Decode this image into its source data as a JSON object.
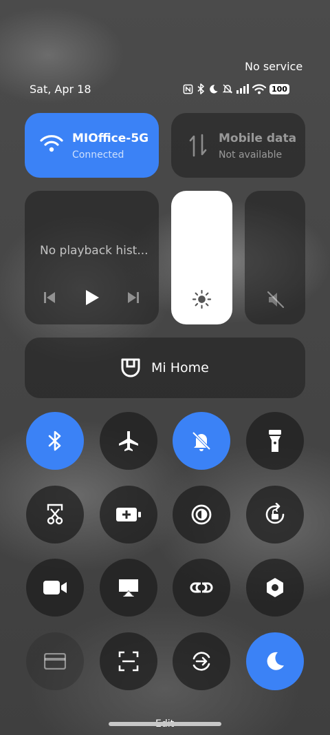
{
  "status": {
    "carrier": "No service",
    "date": "Sat, Apr 18",
    "battery": "100"
  },
  "wifi_tile": {
    "name": "MIOffice-5G",
    "status": "Connected"
  },
  "mobile_tile": {
    "title": "Mobile data",
    "status": "Not available"
  },
  "media": {
    "text": "No playback hist..."
  },
  "brightness_level": 1.0,
  "mi_home": {
    "label": "Mi Home"
  },
  "toggles": [
    {
      "name": "bluetooth",
      "active": true
    },
    {
      "name": "airplane-mode",
      "active": false
    },
    {
      "name": "mute",
      "active": true
    },
    {
      "name": "flashlight",
      "active": false
    },
    {
      "name": "screenshot",
      "active": false
    },
    {
      "name": "battery-saver",
      "active": false
    },
    {
      "name": "reading-mode",
      "active": false
    },
    {
      "name": "auto-rotate",
      "active": false
    },
    {
      "name": "screen-recorder",
      "active": false
    },
    {
      "name": "cast",
      "active": false
    },
    {
      "name": "link",
      "active": false
    },
    {
      "name": "settings",
      "active": false
    },
    {
      "name": "card",
      "active": false
    },
    {
      "name": "scanner",
      "active": false
    },
    {
      "name": "sync",
      "active": false
    },
    {
      "name": "dark-mode",
      "active": true
    }
  ],
  "footer": {
    "edit_label": "Edit"
  },
  "colors": {
    "accent": "#3b82f6"
  }
}
